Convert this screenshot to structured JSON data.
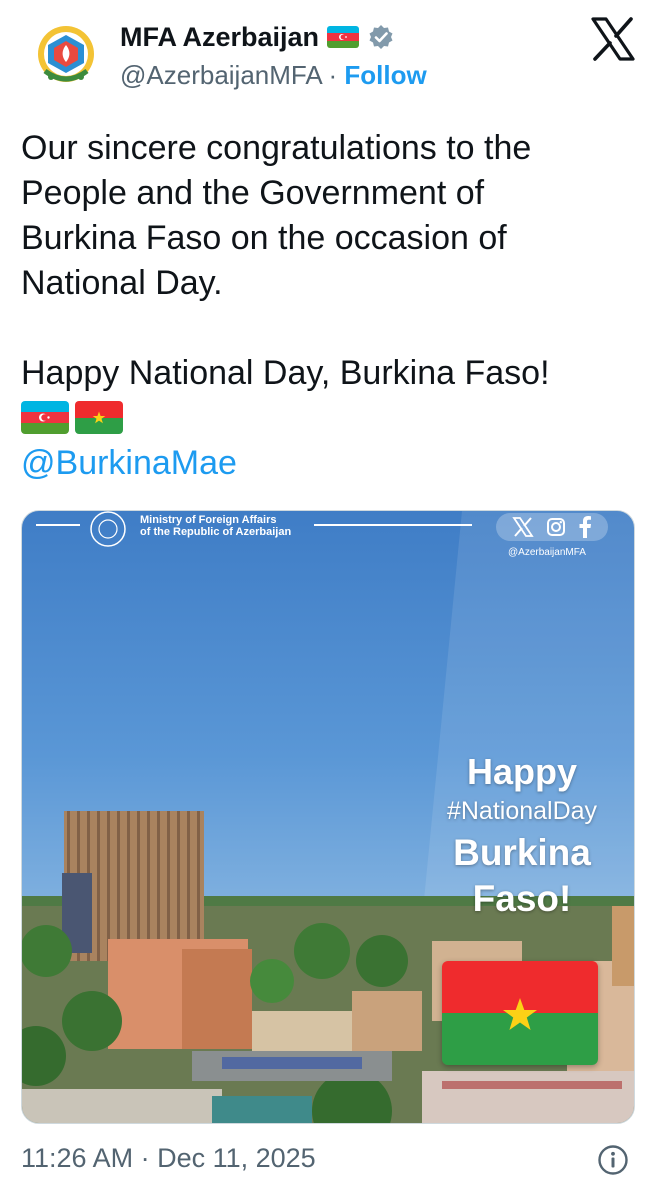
{
  "author": {
    "display_name": "MFA Azerbaijan",
    "handle": "@AzerbaijanMFA",
    "separator": "·",
    "follow_label": "Follow"
  },
  "tweet": {
    "lines": [
      "Our sincere congratulations to the",
      "People and the Government of",
      "Burkina Faso on the occasion of",
      "National Day."
    ],
    "line2": "Happy National Day, Burkina Faso!",
    "flags": [
      "azerbaijan-flag",
      "burkina-faso-flag"
    ],
    "mention": "@BurkinaMae"
  },
  "media": {
    "ministry_line1": "Ministry of Foreign Affairs",
    "ministry_line2": "of the Republic of Azerbaijan",
    "social_handle": "@AzerbaijanMFA",
    "overlay_happy": "Happy",
    "overlay_hashtag": "#NationalDay",
    "overlay_burkina": "Burkina",
    "overlay_faso": "Faso!"
  },
  "footer": {
    "timestamp": "11:26 AM · Dec 11, 2025"
  },
  "icons": {
    "platform": "x-logo-icon",
    "verified": "verified-badge-icon",
    "info": "info-icon"
  },
  "colors": {
    "link": "#1d9bf0",
    "secondary_text": "#536471",
    "burkina_red": "#ef2b2d",
    "burkina_green": "#2e9e46",
    "burkina_star": "#fcd116",
    "az_blue": "#00b5e2",
    "az_red": "#ef3340",
    "az_green": "#509e2f"
  }
}
